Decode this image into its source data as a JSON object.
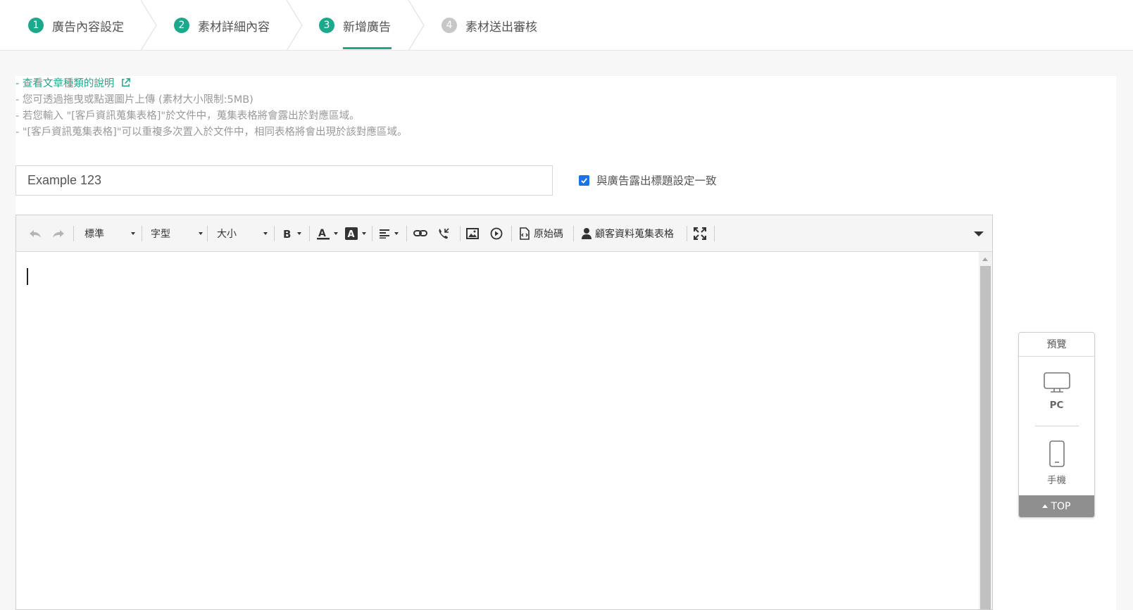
{
  "steps": [
    {
      "num": "1",
      "label": "廣告內容設定",
      "state": "done"
    },
    {
      "num": "2",
      "label": "素材詳細內容",
      "state": "done"
    },
    {
      "num": "3",
      "label": "新增廣告",
      "state": "active"
    },
    {
      "num": "4",
      "label": "素材送出審核",
      "state": "pending"
    }
  ],
  "notes": {
    "link": "- 查看文章種類的說明",
    "line1": "- 您可透過拖曳或點選圖片上傳 (素材大小限制:5MB)",
    "line2": "- 若您輸入 \"[客戶資訊蒐集表格]\"於文件中，蒐集表格將會露出於對應區域。",
    "line3": "- \"[客戶資訊蒐集表格]\"可以重複多次置入於文件中，相同表格將會出現於該對應區域。"
  },
  "title_input": {
    "value": "Example 123"
  },
  "sync_checkbox": {
    "label": "與廣告露出標題設定一致",
    "checked": true
  },
  "toolbar": {
    "format_label": "標準",
    "font_label": "字型",
    "size_label": "大小",
    "source_label": "原始碼",
    "form_label": "顧客資料蒐集表格"
  },
  "preview": {
    "title": "預覽",
    "pc_label": "PC",
    "mobile_label": "手機",
    "top_label": "TOP"
  },
  "colors": {
    "accent": "#1aa98b",
    "checkbox": "#1a73e8",
    "top_button": "#8f8f8f"
  }
}
